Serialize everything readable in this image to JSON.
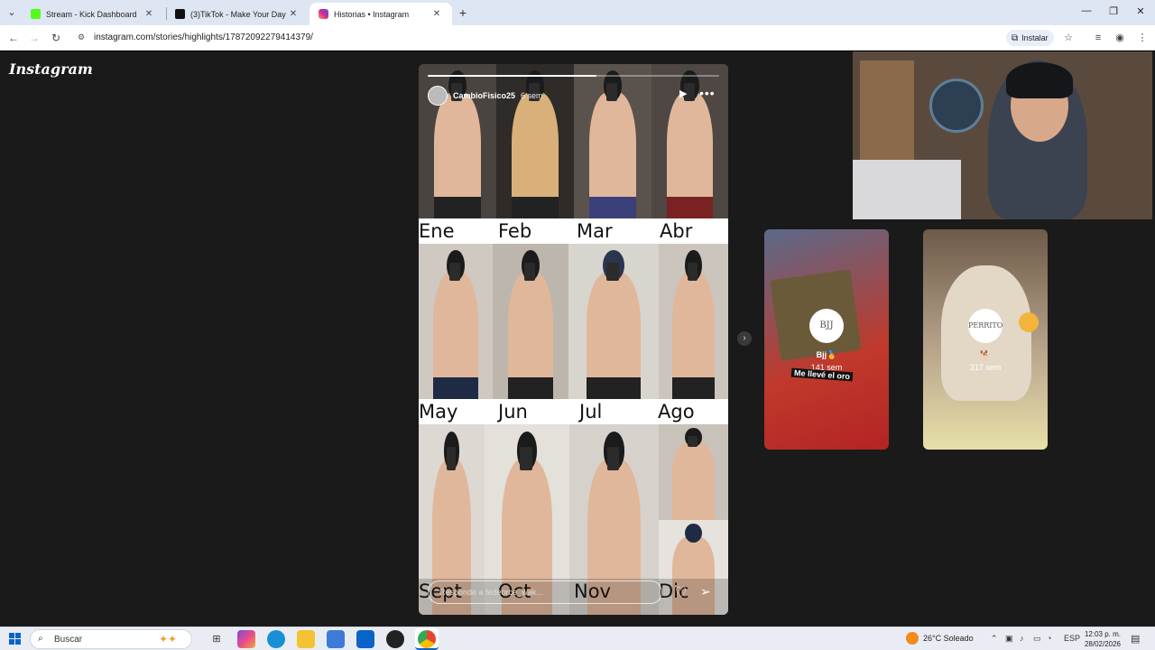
{
  "browser": {
    "tabs": [
      {
        "title": "Stream - Kick Dashboard",
        "favicon_color": "#53fc18"
      },
      {
        "title": "(3)TikTok - Make Your Day",
        "favicon_color": "#111111"
      },
      {
        "title": "Historias • Instagram",
        "favicon_color": "#d6249f"
      }
    ],
    "url": "instagram.com/stories/highlights/17872092279414379/",
    "install_label": "Instalar"
  },
  "page": {
    "logo": "Instagram",
    "story": {
      "username": "CambioFisico25",
      "age": "6 sem",
      "progress": 0.58,
      "months": [
        "Ene",
        "Feb",
        "Mar",
        "Abr",
        "May",
        "Jun",
        "Jul",
        "Ago",
        "Sept",
        "Oct",
        "Nov",
        "Dic"
      ],
      "reply_placeholder": "Responde a fedeorce_wak..."
    },
    "highlights": [
      {
        "circle_text": "BJJ",
        "title": "Bjj🥇",
        "age": "141 sem",
        "caption": "Me llevé el oro"
      },
      {
        "circle_text": "PERRITO",
        "title": "🐕",
        "age": "317 sem"
      }
    ]
  },
  "taskbar": {
    "search_label": "Buscar",
    "weather": "26°C  Soleado",
    "lang": "ESP",
    "time": "12:03 p. m.",
    "date": "28/02/2026"
  },
  "colors": {
    "page_bg": "#1a1a1a",
    "accent": "#0a64c8"
  }
}
